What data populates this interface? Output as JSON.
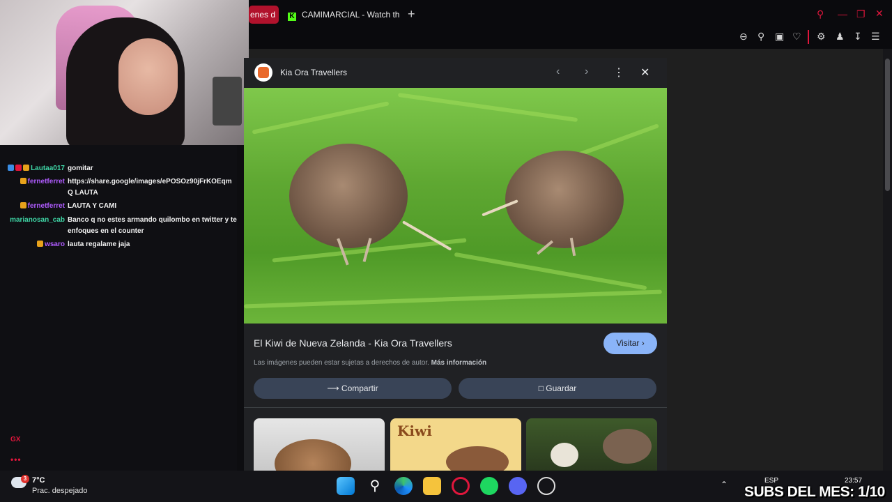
{
  "browser": {
    "tabs": [
      {
        "label": "enes d"
      },
      {
        "label": "CAMIMARCIAL - Watch th"
      }
    ],
    "new_tab": "+"
  },
  "chat": {
    "messages": [
      {
        "user": "Lautaa017",
        "user_color": "#3fd6a6",
        "text": "gomitar"
      },
      {
        "user": "fernetferret",
        "user_color": "#b05cff",
        "text": "https://share.google/images/ePOSOz90jFrKOEqmQ LAUTA"
      },
      {
        "user": "fernetferret",
        "user_color": "#b05cff",
        "text": "LAUTA Y CAMI"
      },
      {
        "user": "marianosan_cab",
        "user_color": "#3fd6a6",
        "text": "Banco q no estes armando quilombo en twitter y te enfoques en el counter"
      },
      {
        "user": "wsaro",
        "user_color": "#b05cff",
        "text": "lauta regalame jaja"
      }
    ],
    "gx_label": "GX",
    "more": "•••"
  },
  "lens": {
    "site_name": "Kia Ora Travellers",
    "title": "El Kiwi de Nueva Zelanda - Kia Ora Travellers",
    "visit_label": "Visitar",
    "copyright_text": "Las imágenes pueden estar sujetas a derechos de autor.",
    "more_info": "Más información",
    "share_label": "Compartir",
    "save_label": "Guardar"
  },
  "taskbar": {
    "weather_badge": "3",
    "temperature": "7°C",
    "weather_desc": "Prac. despejado",
    "language": "ESP",
    "time": "23:57"
  },
  "overlay": {
    "subs_text": "SUBS DEL MES: 1/10"
  },
  "colors": {
    "accent_red": "#e0163c",
    "visit_blue": "#8ab4f8",
    "kick_green": "#53fc18"
  }
}
